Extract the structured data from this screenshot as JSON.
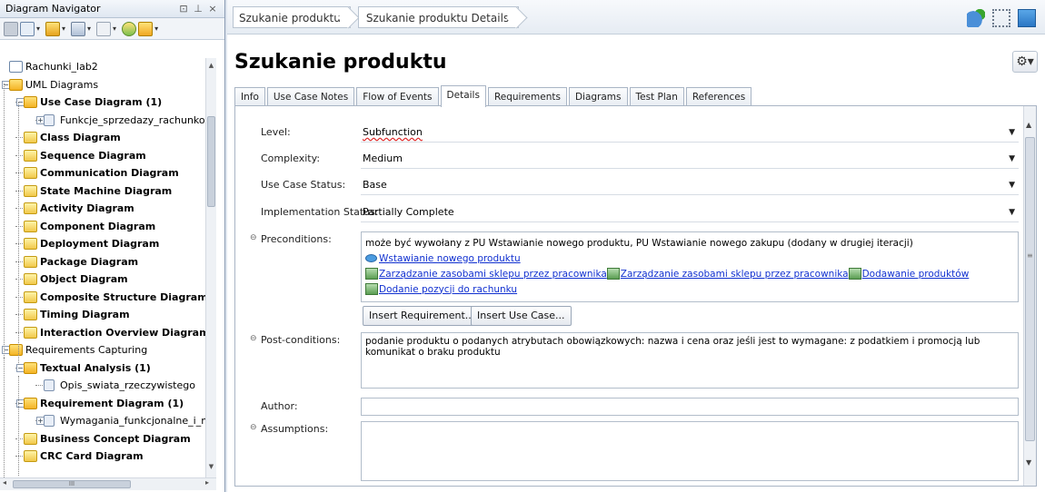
{
  "navigator": {
    "title": "Diagram Navigator",
    "header_buttons": [
      "⊡",
      "⊥",
      "×"
    ],
    "tree": [
      {
        "label": "Rachunki_lab2",
        "bold": false,
        "indent": 0,
        "icon": "project-icon",
        "expander": ""
      },
      {
        "label": "UML Diagrams",
        "bold": false,
        "indent": 0,
        "icon": "folder-icon",
        "expander": "−"
      },
      {
        "label": "Use Case Diagram (1)",
        "bold": true,
        "indent": 1,
        "icon": "folder-icon",
        "expander": "−"
      },
      {
        "label": "Funkcje_sprzedazy_rachunkow",
        "bold": false,
        "indent": 2,
        "icon": "diagram-file-icon",
        "expander": "+"
      },
      {
        "label": "Class Diagram",
        "bold": true,
        "indent": 1,
        "icon": "diagram-type-icon",
        "expander": ""
      },
      {
        "label": "Sequence Diagram",
        "bold": true,
        "indent": 1,
        "icon": "diagram-type-icon",
        "expander": ""
      },
      {
        "label": "Communication Diagram",
        "bold": true,
        "indent": 1,
        "icon": "diagram-type-icon",
        "expander": ""
      },
      {
        "label": "State Machine Diagram",
        "bold": true,
        "indent": 1,
        "icon": "diagram-type-icon",
        "expander": ""
      },
      {
        "label": "Activity Diagram",
        "bold": true,
        "indent": 1,
        "icon": "diagram-type-icon",
        "expander": ""
      },
      {
        "label": "Component Diagram",
        "bold": true,
        "indent": 1,
        "icon": "diagram-type-icon",
        "expander": ""
      },
      {
        "label": "Deployment Diagram",
        "bold": true,
        "indent": 1,
        "icon": "diagram-type-icon",
        "expander": ""
      },
      {
        "label": "Package Diagram",
        "bold": true,
        "indent": 1,
        "icon": "diagram-type-icon",
        "expander": ""
      },
      {
        "label": "Object Diagram",
        "bold": true,
        "indent": 1,
        "icon": "diagram-type-icon",
        "expander": ""
      },
      {
        "label": "Composite Structure Diagram",
        "bold": true,
        "indent": 1,
        "icon": "diagram-type-icon",
        "expander": ""
      },
      {
        "label": "Timing Diagram",
        "bold": true,
        "indent": 1,
        "icon": "diagram-type-icon",
        "expander": ""
      },
      {
        "label": "Interaction Overview Diagram",
        "bold": true,
        "indent": 1,
        "icon": "diagram-type-icon",
        "expander": ""
      },
      {
        "label": "Requirements Capturing",
        "bold": false,
        "indent": 0,
        "icon": "folder-icon",
        "expander": "−"
      },
      {
        "label": "Textual Analysis (1)",
        "bold": true,
        "indent": 1,
        "icon": "folder-icon",
        "expander": "−"
      },
      {
        "label": "Opis_swiata_rzeczywistego",
        "bold": false,
        "indent": 2,
        "icon": "diagram-file-icon",
        "expander": ""
      },
      {
        "label": "Requirement Diagram (1)",
        "bold": true,
        "indent": 1,
        "icon": "folder-icon",
        "expander": "−"
      },
      {
        "label": "Wymagania_funkcjonalne_i_nief",
        "bold": false,
        "indent": 2,
        "icon": "diagram-file-icon",
        "expander": "+"
      },
      {
        "label": "Business Concept Diagram",
        "bold": true,
        "indent": 1,
        "icon": "diagram-type-icon",
        "expander": ""
      },
      {
        "label": "CRC Card Diagram",
        "bold": true,
        "indent": 1,
        "icon": "diagram-type-icon",
        "expander": ""
      }
    ],
    "hscroll_grip": "III"
  },
  "breadcrumb": [
    "Szukanie produktu",
    "Szukanie produktu Details"
  ],
  "page_title": "Szukanie produktu",
  "tabs": [
    {
      "label": "Info",
      "active": false
    },
    {
      "label": "Use Case Notes",
      "active": false
    },
    {
      "label": "Flow of Events",
      "active": false
    },
    {
      "label": "Details",
      "active": true
    },
    {
      "label": "Requirements",
      "active": false
    },
    {
      "label": "Diagrams",
      "active": false
    },
    {
      "label": "Test Plan",
      "active": false
    },
    {
      "label": "References",
      "active": false
    }
  ],
  "details": {
    "level": {
      "label": "Level:",
      "value": "Subfunction"
    },
    "complexity": {
      "label": "Complexity:",
      "value": "Medium"
    },
    "status": {
      "label": "Use Case Status:",
      "value": "Base"
    },
    "implementation": {
      "label": "Implementation Status:",
      "value": "Partially Complete"
    },
    "preconditions": {
      "label": "Preconditions:",
      "text": "może być wywołany z PU Wstawianie nowego produktu, PU Wstawianie nowego zakupu (dodany w drugiej iteracji)",
      "use_case_link": "Wstawianie nowego produktu",
      "req_links_row1": [
        "Zarządzanie zasobami sklepu przez pracownika",
        "Zarządzanie zasobami sklepu przez pracownika",
        "Dodawanie produktów"
      ],
      "req_links_row2": [
        "Dodanie pozycji do rachunku"
      ]
    },
    "insert_requirement_button": "Insert Requirement...",
    "insert_use_case_button": "Insert Use Case...",
    "postconditions": {
      "label": "Post-conditions:",
      "text": "podanie produktu o podanych atrybutach obowiązkowych: nazwa i cena oraz jeśli jest to wymagane: z podatkiem i promocją lub komunikat o braku produktu"
    },
    "author": {
      "label": "Author:",
      "value": ""
    },
    "assumptions": {
      "label": "Assumptions:",
      "value": ""
    }
  },
  "colors": {
    "link": "#1030d0",
    "panel_bg": "#dfe6ef",
    "folder": "#f4b324"
  }
}
